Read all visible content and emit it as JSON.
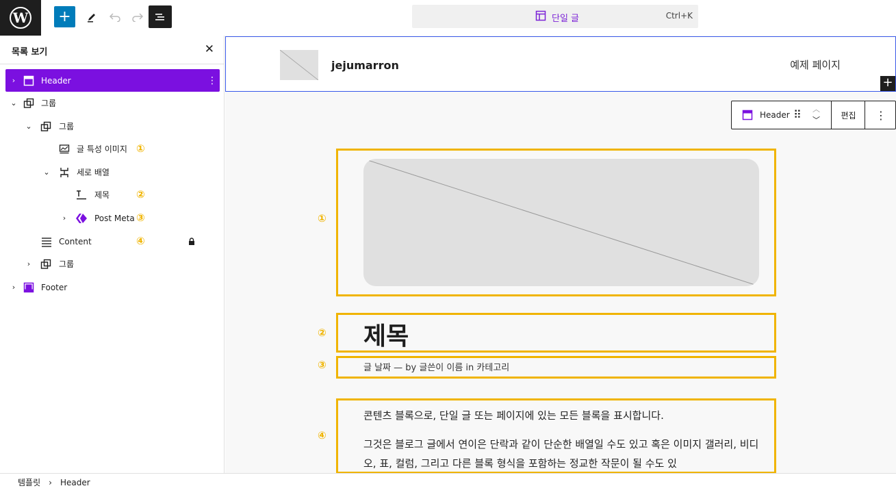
{
  "topbar": {
    "command_title": "단일 글",
    "command_shortcut": "Ctrl+K"
  },
  "sidebar": {
    "title": "목록 보기",
    "items": [
      {
        "label": "Header"
      },
      {
        "label": "그룹"
      },
      {
        "label": "그룹"
      },
      {
        "label": "글 특성 이미지",
        "marker": "①"
      },
      {
        "label": "세로 배열"
      },
      {
        "label": "제목",
        "marker": "②"
      },
      {
        "label": "Post Meta",
        "marker": "③"
      },
      {
        "label": "Content",
        "marker": "④"
      },
      {
        "label": "그룹"
      },
      {
        "label": "Footer"
      }
    ]
  },
  "canvas": {
    "site_title": "jejumarron",
    "page_link": "예제 페이지",
    "block_toolbar": {
      "block_name": "Header",
      "edit_label": "편집"
    },
    "markers": [
      "①",
      "②",
      "③",
      "④"
    ],
    "post_title": "제목",
    "post_meta": "글 날짜 — by 글쓴이 이름 in 카테고리",
    "content_p1": "콘텐츠 블록으로, 단일 글 또는 페이지에 있는 모든 블록을 표시합니다.",
    "content_p2": "그것은 블로그 글에서 연이은 단락과 같이 단순한 배열일 수도 있고 혹은 이미지 갤러리, 비디오, 표, 컬럼, 그리고 다른 블록 형식을 포함하는 정교한 작문이 될 수도 있"
  },
  "statusbar": {
    "crumbs": [
      "템플릿",
      "Header"
    ]
  },
  "colors": {
    "accent": "#7b10e0",
    "marker": "#f0b400",
    "wp_blue": "#007cba"
  }
}
